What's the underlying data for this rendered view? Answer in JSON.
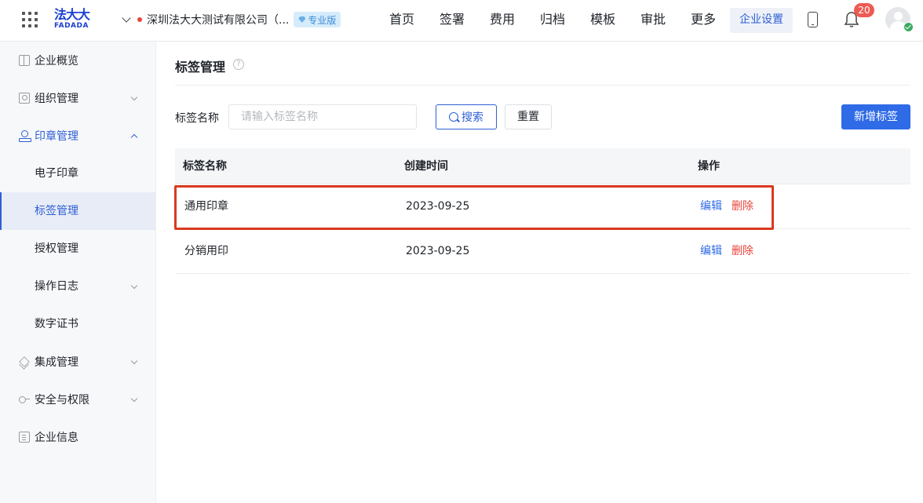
{
  "header": {
    "logo_cn": "法大大",
    "logo_en": "FADADA",
    "company_name": "深圳法大大测试有限公司（...",
    "edition_badge": "专业版",
    "nav": [
      "首页",
      "签署",
      "费用",
      "归档",
      "模板",
      "审批",
      "更多"
    ],
    "nav_active": "企业设置",
    "notification_count": "20"
  },
  "sidebar": {
    "items": [
      {
        "label": "企业概览",
        "icon": "grid-icon"
      },
      {
        "label": "组织管理",
        "icon": "org-icon"
      },
      {
        "label": "印章管理",
        "icon": "stamp-icon"
      },
      {
        "label": "电子印章"
      },
      {
        "label": "标签管理"
      },
      {
        "label": "授权管理"
      },
      {
        "label": "操作日志"
      },
      {
        "label": "数字证书"
      },
      {
        "label": "集成管理",
        "icon": "layers-icon"
      },
      {
        "label": "安全与权限",
        "icon": "key-icon"
      },
      {
        "label": "企业信息",
        "icon": "info-icon"
      }
    ],
    "selected": "标签管理"
  },
  "main": {
    "title": "标签管理",
    "help_icon": "?",
    "filter_label": "标签名称",
    "filter_placeholder": "请输入标签名称",
    "search_label": "搜索",
    "reset_label": "重置",
    "new_label": "新增标签",
    "table": {
      "headers": [
        "标签名称",
        "创建时间",
        "操作"
      ],
      "rows": [
        {
          "name": "通用印章",
          "created": "2023-09-25",
          "edit": "编辑",
          "delete": "删除"
        },
        {
          "name": "分销用印",
          "created": "2023-09-25",
          "edit": "编辑",
          "delete": "删除"
        }
      ]
    }
  },
  "colors": {
    "accent": "#2f6be6",
    "danger": "#e8453c",
    "highlight_border": "#d9391f"
  }
}
